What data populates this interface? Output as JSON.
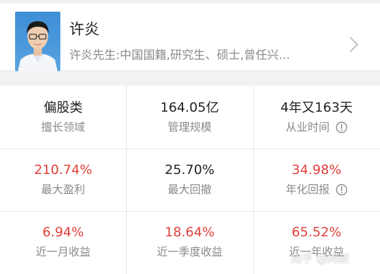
{
  "profile": {
    "name": "许炎",
    "bio": "许炎先生:中国国籍,研究生、硕士,曾任兴...",
    "avatar_icon": "manager-portrait",
    "chevron_icon": "chevron-right-icon"
  },
  "stats": [
    [
      {
        "value": "偏股类",
        "label": "擅长领域",
        "value_color": "#222222",
        "info_icon": false
      },
      {
        "value": "164.05亿",
        "label": "管理规模",
        "value_color": "#222222",
        "info_icon": false
      },
      {
        "value": "4年又163天",
        "label": "从业时间",
        "value_color": "#222222",
        "info_icon": true
      }
    ],
    [
      {
        "value": "210.74%",
        "label": "最大盈利",
        "value_color": "#e0403a",
        "info_icon": false
      },
      {
        "value": "25.70%",
        "label": "最大回撤",
        "value_color": "#222222",
        "info_icon": false
      },
      {
        "value": "34.98%",
        "label": "年化回报",
        "value_color": "#e0403a",
        "info_icon": true
      }
    ],
    [
      {
        "value": "6.94%",
        "label": "近一月收益",
        "value_color": "#e0403a",
        "info_icon": false
      },
      {
        "value": "18.64%",
        "label": "近一季度收益",
        "value_color": "#e0403a",
        "info_icon": false
      },
      {
        "value": "65.52%",
        "label": "近一年收益",
        "value_color": "#e0403a",
        "info_icon": false
      }
    ]
  ],
  "watermark": {
    "text": "知乎 @网叔"
  }
}
